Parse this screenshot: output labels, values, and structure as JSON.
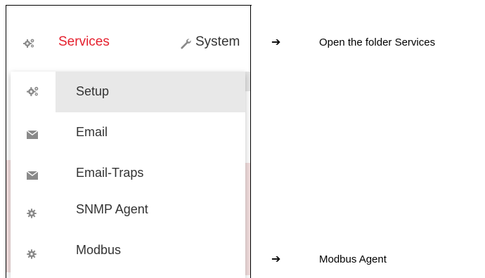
{
  "nav": {
    "services_label": "Services",
    "system_label": "System",
    "services_icon": "gears-icon",
    "system_icon": "wrench-icon",
    "active_color": "#e5202e"
  },
  "menu": {
    "items": [
      {
        "label": "Setup",
        "icon": "gears-icon"
      },
      {
        "label": "Email",
        "icon": "envelope-icon"
      },
      {
        "label": "Email-Traps",
        "icon": "envelope-icon"
      },
      {
        "label": "SNMP Agent",
        "icon": "gear-icon"
      },
      {
        "label": "Modbus",
        "icon": "gear-icon"
      }
    ]
  },
  "annotations": {
    "services_arrow": "➔",
    "services_text": "Open the folder Services",
    "modbus_arrow": "➔",
    "modbus_text": "Modbus Agent"
  }
}
